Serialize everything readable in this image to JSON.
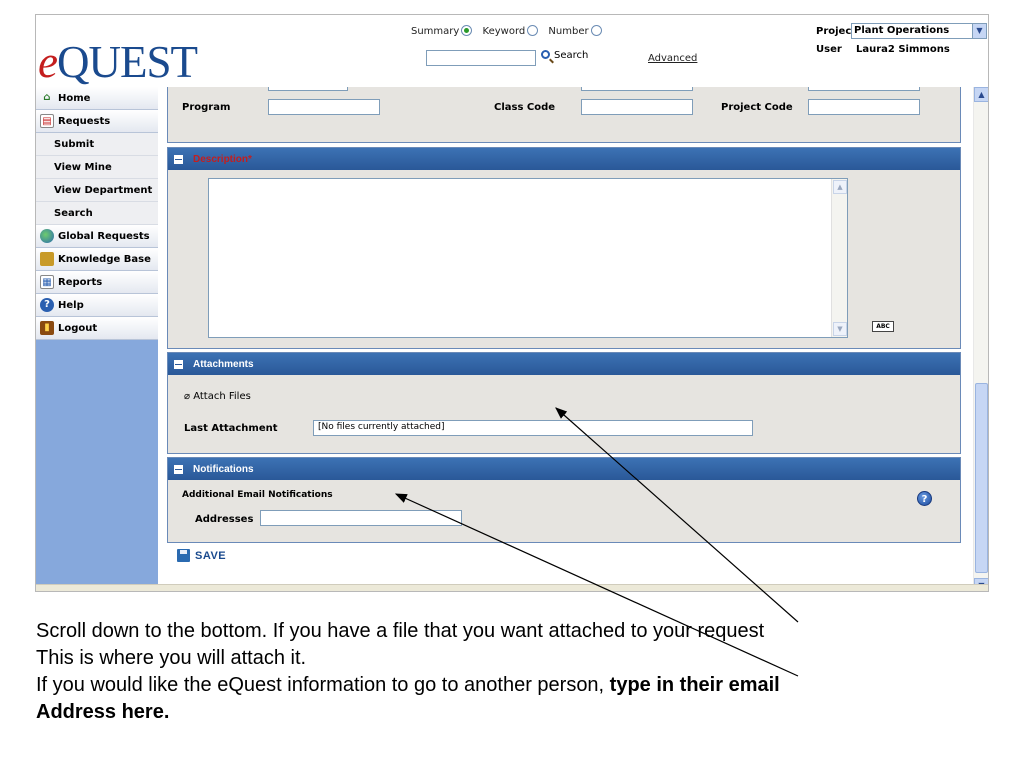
{
  "header": {
    "logo_e": "e",
    "logo_rest": "QUEST",
    "search_modes": [
      {
        "label": "Summary",
        "selected": true
      },
      {
        "label": "Keyword",
        "selected": false
      },
      {
        "label": "Number",
        "selected": false
      }
    ],
    "search_button": "Search",
    "advanced_link": "Advanced",
    "project_label": "Project",
    "project_value": "Plant Operations",
    "user_label": "User",
    "user_name": "Laura2 Simmons"
  },
  "sidebar": {
    "items": [
      {
        "label": "Home",
        "icon": "home-icon"
      },
      {
        "label": "Requests",
        "icon": "requests-icon"
      },
      {
        "label": "Submit"
      },
      {
        "label": "View Mine"
      },
      {
        "label": "View Department"
      },
      {
        "label": "Search"
      },
      {
        "label": "Global Requests",
        "icon": "globe-icon"
      },
      {
        "label": "Knowledge Base",
        "icon": "knowledge-base-icon"
      },
      {
        "label": "Reports",
        "icon": "reports-icon"
      },
      {
        "label": "Help",
        "icon": "help-icon"
      },
      {
        "label": "Logout",
        "icon": "logout-icon"
      }
    ]
  },
  "form": {
    "program_label": "Program",
    "class_code_label": "Class Code",
    "project_code_label": "Project Code",
    "description_title": "Description",
    "description_required": "*",
    "attachments_title": "Attachments",
    "attach_files": "Attach Files",
    "last_attachment_label": "Last Attachment",
    "last_attachment_value": "[No files currently attached]",
    "notifications_title": "Notifications",
    "additional_email_label": "Additional Email Notifications",
    "addresses_label": "Addresses",
    "save_label": "SAVE",
    "spell_check": "ABC"
  },
  "caption": {
    "line1": "Scroll down to the bottom. If you have a file that you want attached to your request",
    "line2": "This is where you will attach it.",
    "line3_plain": "If you would like the eQuest information to go to another person, ",
    "line3_bold": "type in their email",
    "line4_bold": "Address here."
  },
  "colors": {
    "panel_header": "#2a5898",
    "sidebar_bg": "#86a8dc",
    "logo_blue": "#1a4a8e",
    "logo_red": "#c41e1e"
  }
}
